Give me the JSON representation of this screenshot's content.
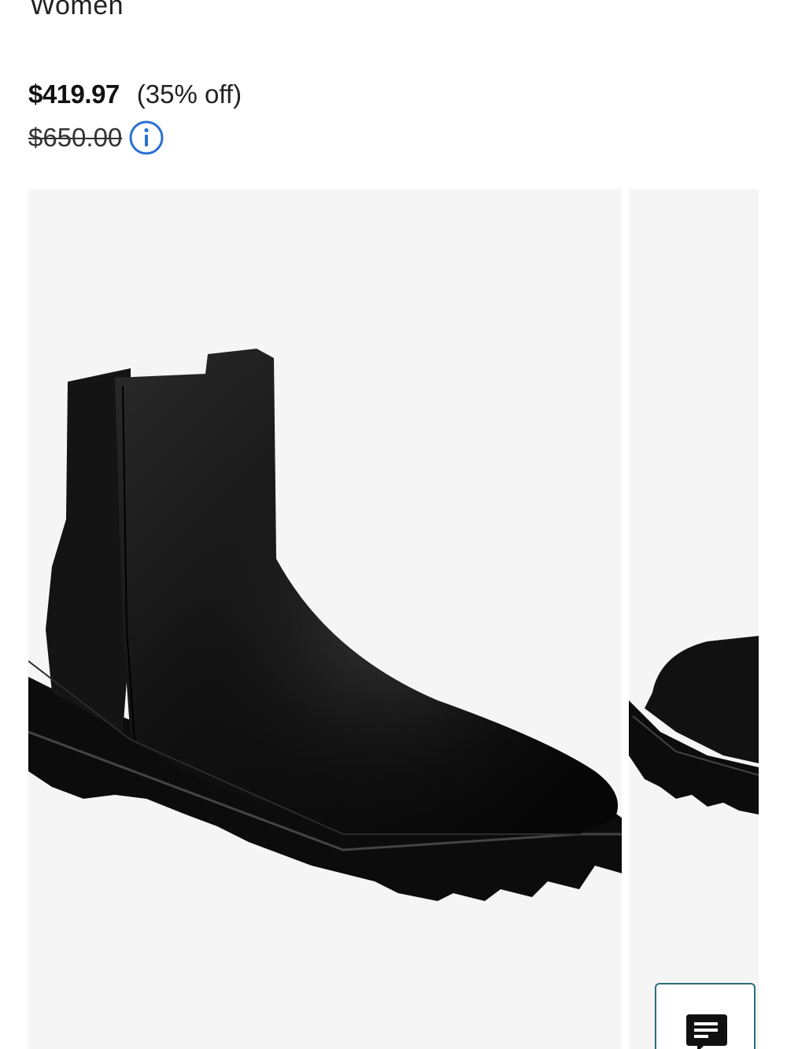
{
  "product": {
    "category": "Women",
    "sale_price": "$419.97",
    "discount": "(35% off)",
    "original_price": "$650.00"
  },
  "icons": {
    "info": "info-circle-icon",
    "chat": "chat-lines-icon"
  },
  "colors": {
    "info_icon": "#2b6fd1",
    "chat_border": "#2a6f7d",
    "image_background": "#f5f5f5"
  }
}
